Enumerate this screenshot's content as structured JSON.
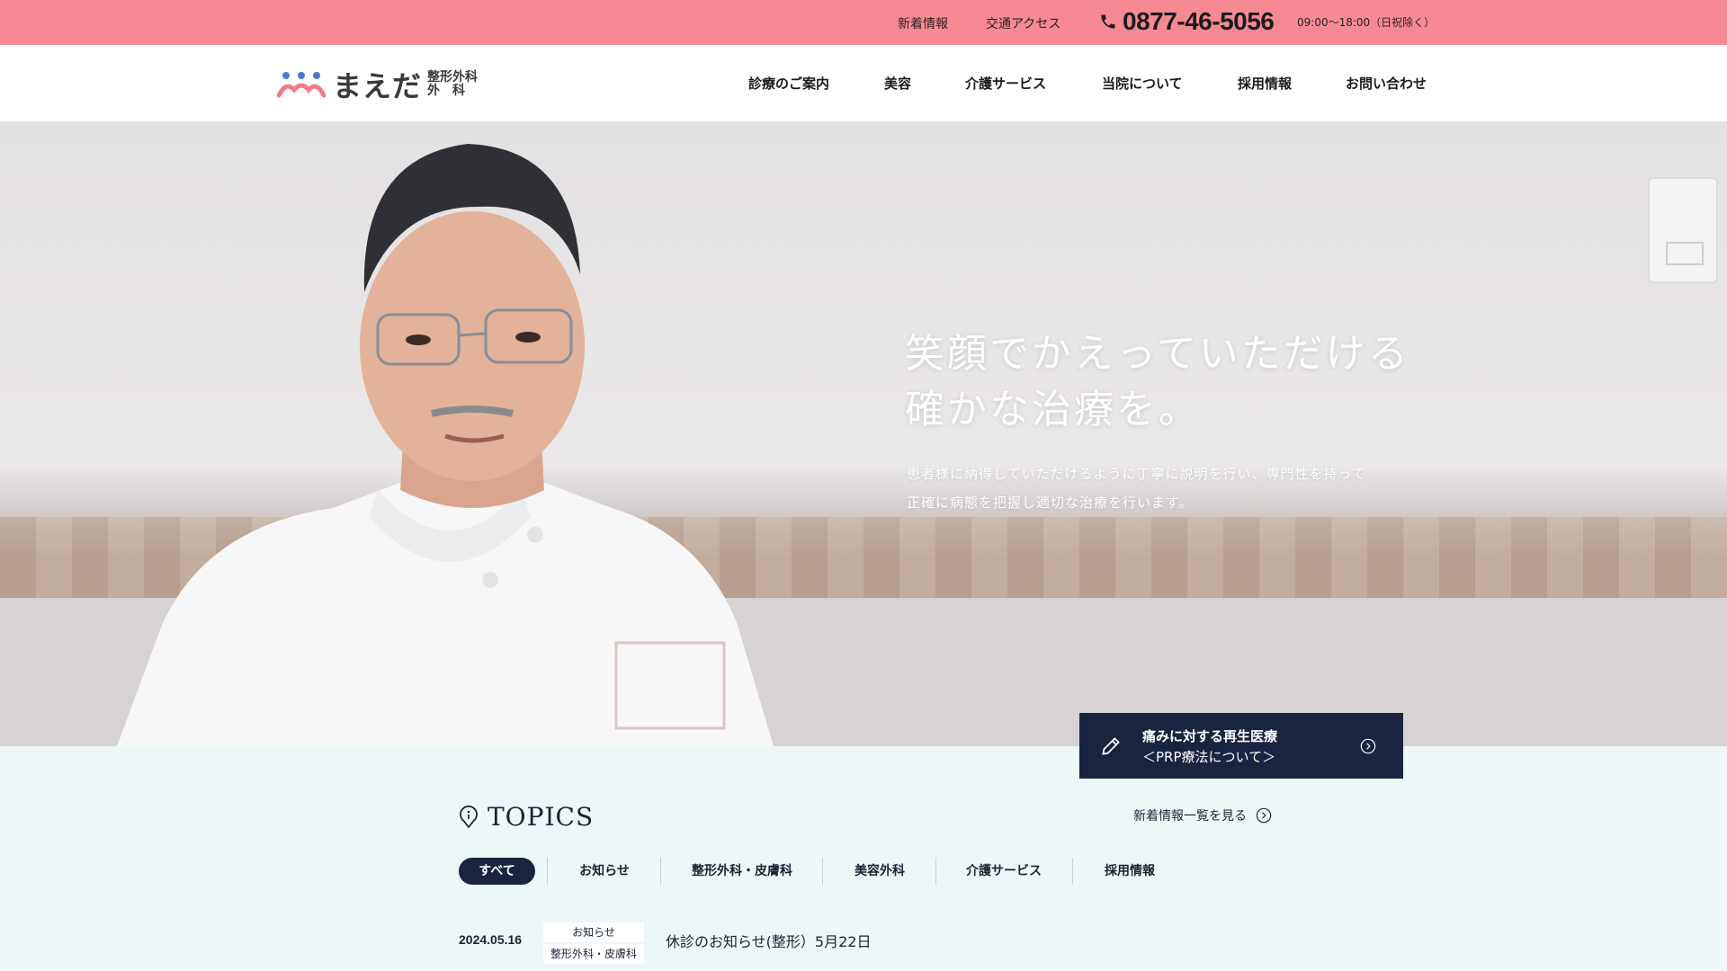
{
  "topbar": {
    "news": "新着情報",
    "access": "交通アクセス",
    "phone": "0877-46-5056",
    "hours": "09:00〜18:00（日祝除く）"
  },
  "logo": {
    "main": "まえだ",
    "sub_line1": "整形外科",
    "sub_line2": "外　科"
  },
  "nav": [
    {
      "label": "診療のご案内"
    },
    {
      "label": "美容"
    },
    {
      "label": "介護サービス"
    },
    {
      "label": "当院について"
    },
    {
      "label": "採用情報"
    },
    {
      "label": "お問い合わせ"
    }
  ],
  "hero": {
    "title_line1": "笑顔でかえっていただける",
    "title_line2": "確かな治療を。",
    "text_line1": "患者様に納得していただけるように丁寧に説明を行い、専門性を持って",
    "text_line2": "正確に病態を把握し適切な治療を行います。"
  },
  "prp": {
    "title": "痛みに対する再生医療",
    "subtitle": "＜PRP療法について＞"
  },
  "topics": {
    "title": "TOPICS",
    "more": "新着情報一覧を見る",
    "tabs": [
      {
        "label": "すべて"
      },
      {
        "label": "お知らせ"
      },
      {
        "label": "整形外科・皮膚科"
      },
      {
        "label": "美容外科"
      },
      {
        "label": "介護サービス"
      },
      {
        "label": "採用情報"
      }
    ],
    "items": [
      {
        "date": "2024.05.16",
        "categories": [
          "お知らせ",
          "整形外科・皮膚科"
        ],
        "title": "休診のお知らせ(整形）5月22日"
      }
    ]
  },
  "colors": {
    "topbar": "#f58a93",
    "navy": "#1a2440",
    "section_bg": "#eef7f8"
  }
}
